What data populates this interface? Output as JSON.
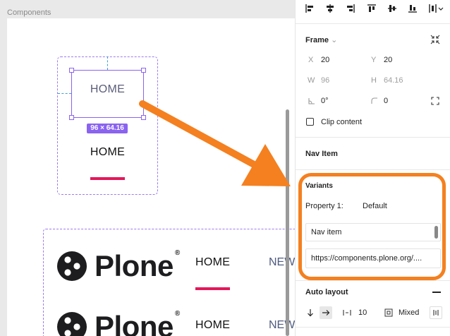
{
  "canvas": {
    "label": "Components",
    "nav_item_frame": {
      "home_hover": "HOME",
      "size_badge": "96 × 64.16",
      "home_active": "HOME"
    },
    "header_component": {
      "logo_text": "Plone",
      "logo_mark": "®",
      "row1": {
        "home": "HOME",
        "news": "NEW"
      },
      "row2": {
        "home": "HOME",
        "news": "NEW"
      }
    }
  },
  "panel": {
    "frame": {
      "title": "Frame",
      "x_label": "X",
      "x_value": "20",
      "y_label": "Y",
      "y_value": "20",
      "w_label": "W",
      "w_value": "96",
      "h_label": "H",
      "h_value": "64.16",
      "rotation_value": "0°",
      "radius_value": "0",
      "clip_content_label": "Clip content"
    },
    "nav_item_title": "Nav Item",
    "variants": {
      "title": "Variants",
      "property_label": "Property 1:",
      "property_value": "Default",
      "name_value": "Nav item",
      "url_value": "https://components.plone.org/...."
    },
    "auto_layout": {
      "title": "Auto layout",
      "spacing_value": "10",
      "padding_value": "Mixed"
    }
  },
  "colors": {
    "accent_purple": "#8a63f0",
    "underline_pink": "#e3175a",
    "annotation_orange": "#f48020"
  }
}
